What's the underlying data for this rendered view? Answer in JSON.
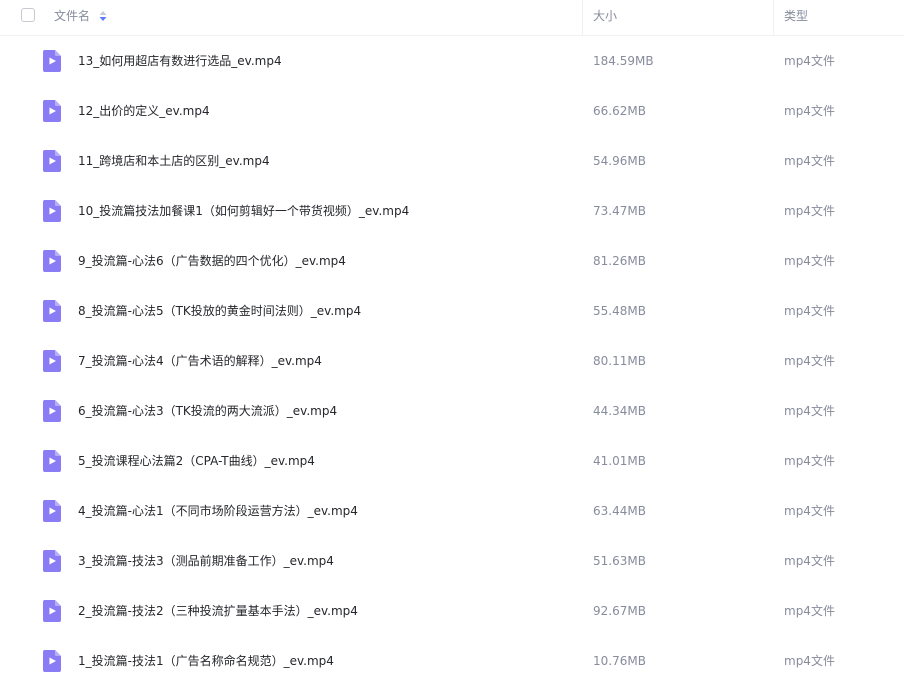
{
  "header": {
    "name_label": "文件名",
    "size_label": "大小",
    "type_label": "类型"
  },
  "colors": {
    "icon_purple": "#8a7cf5",
    "icon_purple_fold": "#b7adf9",
    "sort_active": "#5b7cf7",
    "sort_inactive": "#c5cbd9"
  },
  "files": [
    {
      "name": "13_如何用超店有数进行选品_ev.mp4",
      "size": "184.59MB",
      "type": "mp4文件",
      "icon": "video-file-icon"
    },
    {
      "name": "12_出价的定义_ev.mp4",
      "size": "66.62MB",
      "type": "mp4文件",
      "icon": "video-file-icon"
    },
    {
      "name": "11_跨境店和本土店的区别_ev.mp4",
      "size": "54.96MB",
      "type": "mp4文件",
      "icon": "video-file-icon"
    },
    {
      "name": "10_投流篇技法加餐课1（如何剪辑好一个带货视频）_ev.mp4",
      "size": "73.47MB",
      "type": "mp4文件",
      "icon": "video-file-icon"
    },
    {
      "name": "9_投流篇-心法6（广告数据的四个优化）_ev.mp4",
      "size": "81.26MB",
      "type": "mp4文件",
      "icon": "video-file-icon"
    },
    {
      "name": "8_投流篇-心法5（TK投放的黄金时间法则）_ev.mp4",
      "size": "55.48MB",
      "type": "mp4文件",
      "icon": "video-file-icon"
    },
    {
      "name": "7_投流篇-心法4（广告术语的解释）_ev.mp4",
      "size": "80.11MB",
      "type": "mp4文件",
      "icon": "video-file-icon"
    },
    {
      "name": "6_投流篇-心法3（TK投流的两大流派）_ev.mp4",
      "size": "44.34MB",
      "type": "mp4文件",
      "icon": "video-file-icon"
    },
    {
      "name": "5_投流课程心法篇2（CPA-T曲线）_ev.mp4",
      "size": "41.01MB",
      "type": "mp4文件",
      "icon": "video-file-icon"
    },
    {
      "name": "4_投流篇-心法1（不同市场阶段运营方法）_ev.mp4",
      "size": "63.44MB",
      "type": "mp4文件",
      "icon": "video-file-icon"
    },
    {
      "name": "3_投流篇-技法3（测品前期准备工作）_ev.mp4",
      "size": "51.63MB",
      "type": "mp4文件",
      "icon": "video-file-icon"
    },
    {
      "name": "2_投流篇-技法2（三种投流扩量基本手法）_ev.mp4",
      "size": "92.67MB",
      "type": "mp4文件",
      "icon": "video-file-icon"
    },
    {
      "name": "1_投流篇-技法1（广告名称命名规范）_ev.mp4",
      "size": "10.76MB",
      "type": "mp4文件",
      "icon": "video-file-icon"
    }
  ]
}
